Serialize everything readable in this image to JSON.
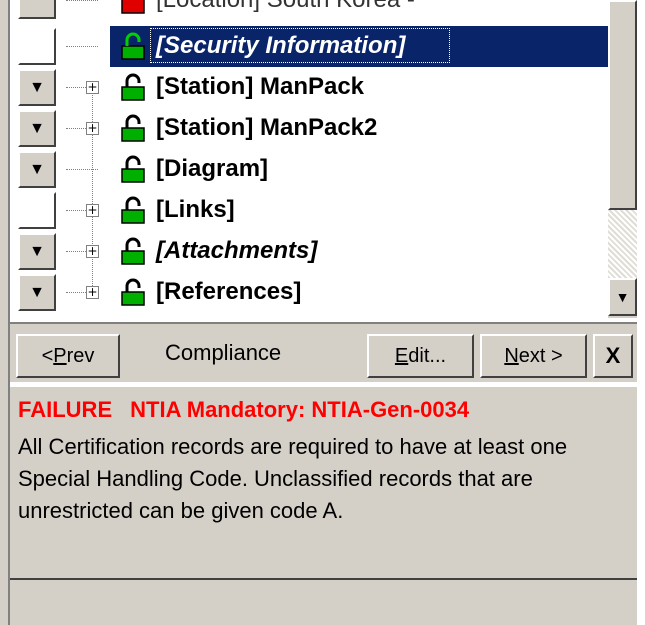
{
  "tree": {
    "partial_top_label": "[Location] South Korea -",
    "items": [
      {
        "label": "[Security Information]",
        "italic": true,
        "selected": true,
        "flag": "white",
        "expander": false
      },
      {
        "label": "[Station] ManPack",
        "italic": false,
        "selected": false,
        "flag": "arrow",
        "expander": true
      },
      {
        "label": "[Station] ManPack2",
        "italic": false,
        "selected": false,
        "flag": "arrow",
        "expander": true
      },
      {
        "label": "[Diagram]",
        "italic": false,
        "selected": false,
        "flag": "arrow",
        "expander": false
      },
      {
        "label": "[Links]",
        "italic": false,
        "selected": false,
        "flag": "white",
        "expander": true
      },
      {
        "label": "[Attachments]",
        "italic": true,
        "selected": false,
        "flag": "arrow",
        "expander": true
      },
      {
        "label": "[References]",
        "italic": false,
        "selected": false,
        "flag": "arrow",
        "expander": true
      }
    ],
    "flag_arrow_glyph": "▼",
    "expander_glyph": "+",
    "scroll_down_glyph": "▼"
  },
  "toolbar": {
    "prev_prefix": "< ",
    "prev_mnemonic": "P",
    "prev_rest": "rev",
    "title": "Compliance",
    "edit_mnemonic": "E",
    "edit_rest": "dit...",
    "next_mnemonic": "N",
    "next_rest": "ext >",
    "close_label": "X"
  },
  "message": {
    "status_word": "FAILURE",
    "rule": "NTIA Mandatory: NTIA-Gen-0034",
    "body": "All Certification records are required to have at least one Special Handling Code.  Unclassified records that are unrestricted can be given code A."
  },
  "colors": {
    "selection": "#0a246a",
    "failure_text": "#ff0000",
    "lock_green": "#00b000",
    "lock_red": "#e00000",
    "panel": "#d4d0c8"
  }
}
